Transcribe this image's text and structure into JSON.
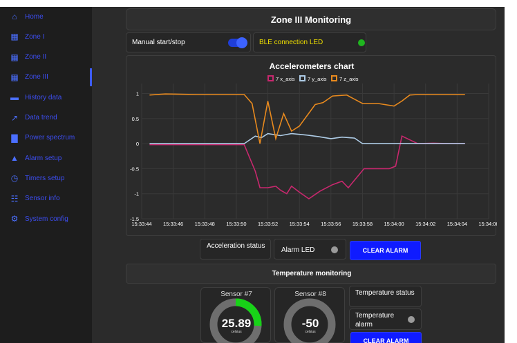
{
  "sidebar": {
    "items": [
      {
        "label": "Home",
        "icon": "home-icon"
      },
      {
        "label": "Zone I",
        "icon": "zone-icon"
      },
      {
        "label": "Zone II",
        "icon": "zone-icon"
      },
      {
        "label": "Zone III",
        "icon": "zone-icon",
        "active": true
      },
      {
        "label": "History data",
        "icon": "folder-icon"
      },
      {
        "label": "Data trend",
        "icon": "trend-icon"
      },
      {
        "label": "Power spectrum",
        "icon": "bar-chart-icon"
      },
      {
        "label": "Alarm setup",
        "icon": "alarm-icon"
      },
      {
        "label": "Timers setup",
        "icon": "clock-icon"
      },
      {
        "label": "Sensor info",
        "icon": "sensor-info-icon"
      },
      {
        "label": "System config",
        "icon": "gear-icon"
      }
    ]
  },
  "header": {
    "title": "Zone III Monitoring"
  },
  "controls": {
    "manual_label": "Manual start/stop",
    "manual_on": true,
    "ble_label": "BLE connection LED",
    "ble_led_color": "#1fb51f"
  },
  "chart_panel": {
    "status_label": "Acceleration status",
    "alarm_led_label": "Alarm LED",
    "alarm_led_color": "#9a9a9a",
    "clear_alarm": "CLEAR ALARM"
  },
  "temperature": {
    "section_title": "Temperature monitoring",
    "sensors": [
      {
        "name": "Sensor #7",
        "value": "25.89",
        "unit": "celsius",
        "fill_fraction": 0.26,
        "fill_color": "#18d218"
      },
      {
        "name": "Sensor #8",
        "value": "-50",
        "unit": "celsius",
        "fill_fraction": 0,
        "fill_color": "#18d218"
      }
    ],
    "status_label": "Temperature status",
    "alarm_label": "Temperature alarm",
    "alarm_led_color": "#9a9a9a",
    "clear_alarm": "CLEAR ALARM"
  },
  "chart_data": {
    "type": "line",
    "title": "Accelerometers chart",
    "x_ticks": [
      "15:33:44",
      "15:33:46",
      "15:33:48",
      "15:33:50",
      "15:33:52",
      "15:33:54",
      "15:33:56",
      "15:33:58",
      "15:34:00",
      "15:34:02",
      "15:34:04",
      "15:34:06"
    ],
    "y_ticks": [
      "1",
      "0.5",
      "0",
      "-0.5",
      "-1",
      "-1.5"
    ],
    "ylim": [
      -1.5,
      1.2
    ],
    "xlim": [
      0,
      22
    ],
    "legend_position": "top",
    "grid": true,
    "series": [
      {
        "name": "7 x_axis",
        "color": "#c8286e",
        "x": [
          0.5,
          1.5,
          3.5,
          6.5,
          7.2,
          7.5,
          8.0,
          8.5,
          8.8,
          9.2,
          9.5,
          10.0,
          10.6,
          11.3,
          12.1,
          12.7,
          13.1,
          14.1,
          15.1,
          15.7,
          16.1,
          16.5,
          17.5,
          18.5,
          19.5,
          20.5
        ],
        "y": [
          -0.02,
          -0.02,
          -0.02,
          -0.02,
          -0.55,
          -0.88,
          -0.88,
          -0.85,
          -0.93,
          -1.0,
          -0.85,
          -0.97,
          -1.1,
          -0.95,
          -0.82,
          -0.75,
          -0.88,
          -0.5,
          -0.5,
          -0.5,
          -0.45,
          0.15,
          0.0,
          0.01,
          0.0,
          0.0
        ]
      },
      {
        "name": "7 y_axis",
        "color": "#aecce6",
        "x": [
          0.5,
          3.5,
          6.5,
          7.2,
          7.6,
          8.0,
          8.8,
          9.5,
          10.5,
          11.2,
          12.0,
          12.7,
          13.5,
          14.0,
          14.8,
          15.7,
          16.5,
          17.5,
          18.5,
          19.5,
          20.5
        ],
        "y": [
          0.0,
          0.0,
          0.0,
          0.15,
          0.12,
          0.2,
          0.16,
          0.2,
          0.17,
          0.14,
          0.1,
          0.13,
          0.11,
          0.0,
          0.0,
          0.0,
          0.0,
          0.0,
          0.0,
          0.0,
          0.0
        ]
      },
      {
        "name": "7 z_axis",
        "color": "#e98a1e",
        "x": [
          0.5,
          1.5,
          3.5,
          6.5,
          7.0,
          7.5,
          8.0,
          8.5,
          9.0,
          9.5,
          10.0,
          11.0,
          11.5,
          12.1,
          13.0,
          14.0,
          15.0,
          16.0,
          16.5,
          17.0,
          17.5,
          20.5
        ],
        "y": [
          0.97,
          0.99,
          0.98,
          0.98,
          0.8,
          0.0,
          0.85,
          0.1,
          0.6,
          0.25,
          0.35,
          0.78,
          0.82,
          0.95,
          0.97,
          0.8,
          0.8,
          0.75,
          0.85,
          0.97,
          0.98,
          0.98
        ]
      }
    ]
  }
}
